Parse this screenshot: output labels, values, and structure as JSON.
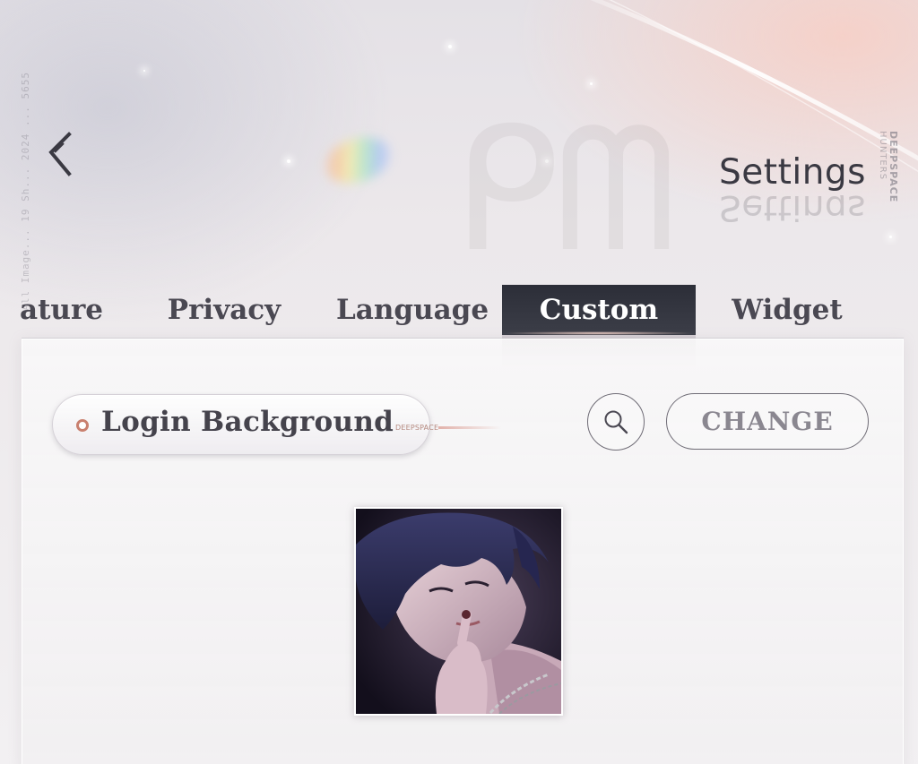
{
  "header": {
    "title": "Settings",
    "back_icon": "chevron-left-icon",
    "brand": [
      "DEEPSPACE",
      "HUNTERS"
    ],
    "side_note": "All Image... 19 Sh... 2024 ... 5655"
  },
  "tabs": [
    {
      "label": "Feature",
      "visible_label": "ature",
      "active": false
    },
    {
      "label": "Privacy",
      "active": false
    },
    {
      "label": "Language",
      "active": false
    },
    {
      "label": "Custom",
      "active": true
    },
    {
      "label": "Widget",
      "active": false
    }
  ],
  "custom": {
    "setting_label": "Login Background",
    "setting_tag": "DEEPSPACE",
    "search_icon": "magnifier-icon",
    "change_label": "CHANGE",
    "preview_image": "portrait of dark-haired man with finger to lips, silver chain"
  },
  "colors": {
    "active_tab_bg": "#2c2e38",
    "text_dark": "#3a3942",
    "accent_bullet": "#c9806f",
    "button_text": "#8a8790"
  }
}
